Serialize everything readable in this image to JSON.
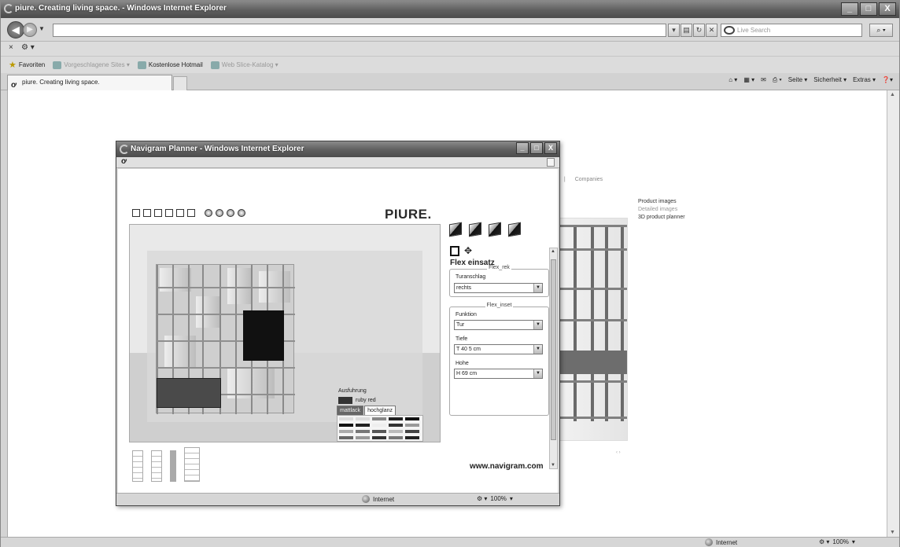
{
  "window": {
    "title": "piure. Creating living space. - Windows Internet Explorer",
    "buttons": {
      "minimize": "_",
      "maximize": "□",
      "close": "X"
    }
  },
  "address": {
    "url": "",
    "search_placeholder": "Live Search"
  },
  "command_bar": {
    "stop": "×"
  },
  "favorites": {
    "items": [
      {
        "label": "Favoriten",
        "icon": "star-icon",
        "dim": false
      },
      {
        "label": "Vorgeschlagene Sites ▾",
        "icon": "ie-page-icon",
        "dim": true
      },
      {
        "label": "Kostenlose Hotmail",
        "icon": "ie-page-icon",
        "dim": false
      },
      {
        "label": "Web Slice-Katalog ▾",
        "icon": "ie-page-icon",
        "dim": true
      }
    ]
  },
  "tabs": {
    "active": "piure. Creating living space.",
    "tools": [
      "Seite ▾",
      "Sicherheit ▾",
      "Extras ▾"
    ]
  },
  "status": {
    "zone": "Internet",
    "zoom": "100%"
  },
  "background_page": {
    "nav": [
      "d",
      "|",
      "Companies"
    ],
    "sidebar": [
      {
        "label": "Product images",
        "dim": false
      },
      {
        "label": "Detailed images",
        "dim": true
      },
      {
        "label": "3D product planner",
        "dim": false
      }
    ],
    "pager": "‹ ›"
  },
  "popup": {
    "title": "Navigram Planner - Windows Internet Explorer",
    "brand": "PIURE.",
    "panel_title": "Flex einsatz",
    "groups": [
      {
        "legend": "Flex_rek",
        "fields": [
          {
            "label": "Turanschlag",
            "value": "rechts"
          }
        ]
      },
      {
        "legend": "Flex_inset",
        "fields": [
          {
            "label": "Funktion",
            "value": "Tur"
          },
          {
            "label": "Tiefe",
            "value": "T 40 5 cm"
          },
          {
            "label": "Hohe",
            "value": "H 69 cm"
          }
        ]
      }
    ],
    "finish": {
      "label": "Ausfuhrung",
      "selected_color": "ruby red",
      "tabs": [
        "mattlack",
        "hochglanz"
      ],
      "active_tab": "hochglanz"
    },
    "footer_url": "www.navigram.com",
    "status": {
      "zone": "Internet",
      "zoom": "100%"
    }
  }
}
